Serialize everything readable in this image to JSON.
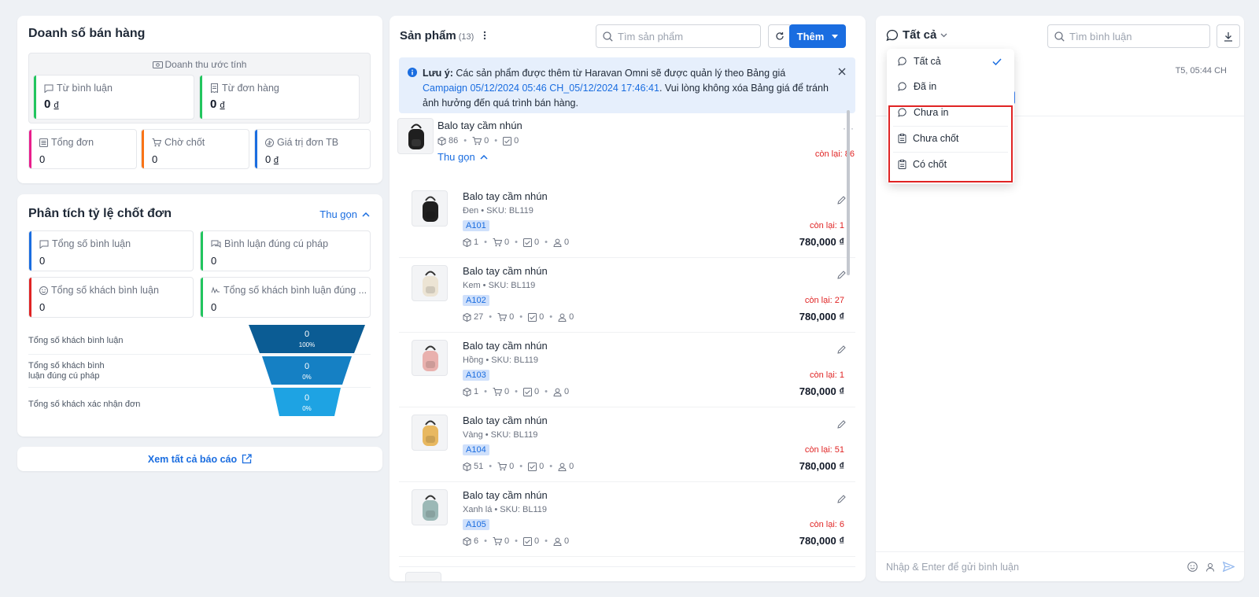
{
  "sales": {
    "title": "Doanh số bán hàng",
    "revenue_caption": "Doanh thu ước tính",
    "from_comments": {
      "label": "Từ bình luận",
      "value": "0",
      "currency": "đ"
    },
    "from_orders": {
      "label": "Từ đơn hàng",
      "value": "0",
      "currency": "đ"
    },
    "total_orders": {
      "label": "Tổng đơn",
      "value": "0"
    },
    "pending": {
      "label": "Chờ chốt",
      "value": "0"
    },
    "avg_value": {
      "label": "Giá trị đơn TB",
      "value": "0",
      "currency": "đ"
    }
  },
  "analysis": {
    "title": "Phân tích tỷ lệ chốt đơn",
    "collapse_label": "Thu gọn",
    "total_comments": {
      "label": "Tổng số bình luận",
      "value": "0"
    },
    "valid_comments": {
      "label": "Bình luận đúng cú pháp",
      "value": "0"
    },
    "total_customers": {
      "label": "Tổng số khách bình luận",
      "value": "0"
    },
    "valid_customers": {
      "label": "Tổng số khách bình luận đúng ...",
      "value": "0"
    },
    "funnel": [
      {
        "label": "Tổng số khách bình luận",
        "value": "0",
        "percent": "100%",
        "color": "#0b5c94"
      },
      {
        "label": "Tổng số khách bình luận đúng cú pháp",
        "value": "0",
        "percent": "0%",
        "color": "#1580c4"
      },
      {
        "label": "Tổng số khách xác nhận đơn",
        "value": "0",
        "percent": "0%",
        "color": "#1ea3e3"
      }
    ]
  },
  "see_all_reports": "Xem tất cả báo cáo",
  "products": {
    "title": "Sản phẩm",
    "count": "(13)",
    "search_placeholder": "Tìm sản phẩm",
    "add_label": "Thêm",
    "notice": {
      "bold": "Lưu ý:",
      "text_before": " Các sản phẩm được thêm từ Haravan Omni sẽ được quản lý theo Bảng giá ",
      "link": "Campaign 05/12/2024 05:46 CH_05/12/2024 17:46:41",
      "text_after": ". Vui lòng không xóa Bảng giá để tránh ảnh hưởng đến quá trình bán hàng."
    },
    "parent": {
      "name": "Balo tay cầm nhún",
      "stock": "86",
      "cart": "0",
      "confirmed": "0",
      "collapse_label": "Thu gọn",
      "remaining": "còn lại: 86"
    },
    "variants": [
      {
        "name": "Balo tay cầm nhún",
        "meta": "Đen • SKU: BL119",
        "tag": "A101",
        "stock": "1",
        "cart": "0",
        "confirmed": "0",
        "customers": "0",
        "remaining": "còn lại: 1",
        "price": "780,000 ₫",
        "color": "#1f1f1f"
      },
      {
        "name": "Balo tay cầm nhún",
        "meta": "Kem • SKU: BL119",
        "tag": "A102",
        "stock": "27",
        "cart": "0",
        "confirmed": "0",
        "customers": "0",
        "remaining": "còn lại: 27",
        "price": "780,000 ₫",
        "color": "#ece4d4"
      },
      {
        "name": "Balo tay cầm nhún",
        "meta": "Hồng • SKU: BL119",
        "tag": "A103",
        "stock": "1",
        "cart": "0",
        "confirmed": "0",
        "customers": "0",
        "remaining": "còn lại: 1",
        "price": "780,000 ₫",
        "color": "#e9b1ae"
      },
      {
        "name": "Balo tay cầm nhún",
        "meta": "Vàng • SKU: BL119",
        "tag": "A104",
        "stock": "51",
        "cart": "0",
        "confirmed": "0",
        "customers": "0",
        "remaining": "còn lại: 51",
        "price": "780,000 ₫",
        "color": "#e8b860"
      },
      {
        "name": "Balo tay cầm nhún",
        "meta": "Xanh lá • SKU: BL119",
        "tag": "A105",
        "stock": "6",
        "cart": "0",
        "confirmed": "0",
        "customers": "0",
        "remaining": "còn lại: 6",
        "price": "780,000 ₫",
        "color": "#9bb8b6"
      }
    ]
  },
  "comments": {
    "filter_label": "Tất cả",
    "search_placeholder": "Tìm bình luận",
    "time": "T5, 05:44 CH",
    "input_placeholder": "Nhập & Enter để gửi bình luận",
    "filter_options": [
      {
        "label": "Tất cả",
        "selected": true
      },
      {
        "label": "Đã in"
      },
      {
        "label": "Chưa in"
      },
      {
        "label": "Chưa chốt"
      },
      {
        "label": "Có chốt"
      }
    ]
  }
}
